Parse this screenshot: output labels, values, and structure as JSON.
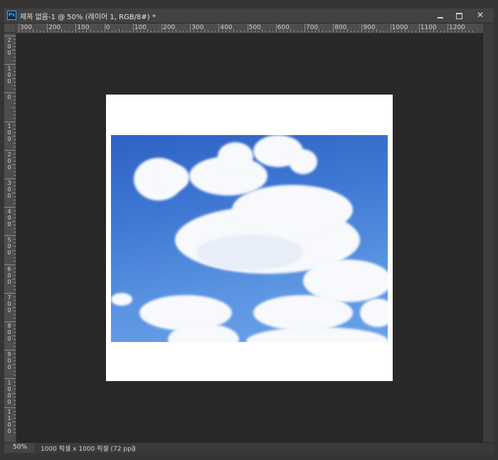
{
  "window": {
    "app_icon": "ps-app-icon",
    "app_icon_text": "Ps",
    "title": "제목 없음-1 @ 50% (레이어 1, RGB/8#) *",
    "controls": {
      "minimize_icon": "minimize-icon",
      "maximize_icon": "maximize-icon",
      "close_icon": "close-icon",
      "close_glyph": "✕"
    }
  },
  "ruler_horizontal": {
    "labels": [
      "300",
      "200",
      "100",
      "0",
      "100",
      "200",
      "300",
      "400",
      "500",
      "600",
      "700",
      "800",
      "900",
      "1000",
      "1100",
      "1200"
    ]
  },
  "ruler_vertical": {
    "labels": [
      "2\n0\n0",
      "1\n0\n0",
      "0",
      "1\n0\n0",
      "2\n0\n0",
      "3\n0\n0",
      "4\n0\n0",
      "5\n0\n0",
      "6\n0\n0",
      "7\n0\n0",
      "8\n0\n0",
      "9\n0\n0",
      "1\n0\n0\n0",
      "1\n1\n0\n0"
    ]
  },
  "document": {
    "canvas_color": "#ffffff",
    "image_description_icon": "sky-clouds-image"
  },
  "status": {
    "zoom": "50%",
    "doc_info": "1000 픽셀 x 1000 픽셀 (72 ppi)",
    "arrow": "〉"
  }
}
